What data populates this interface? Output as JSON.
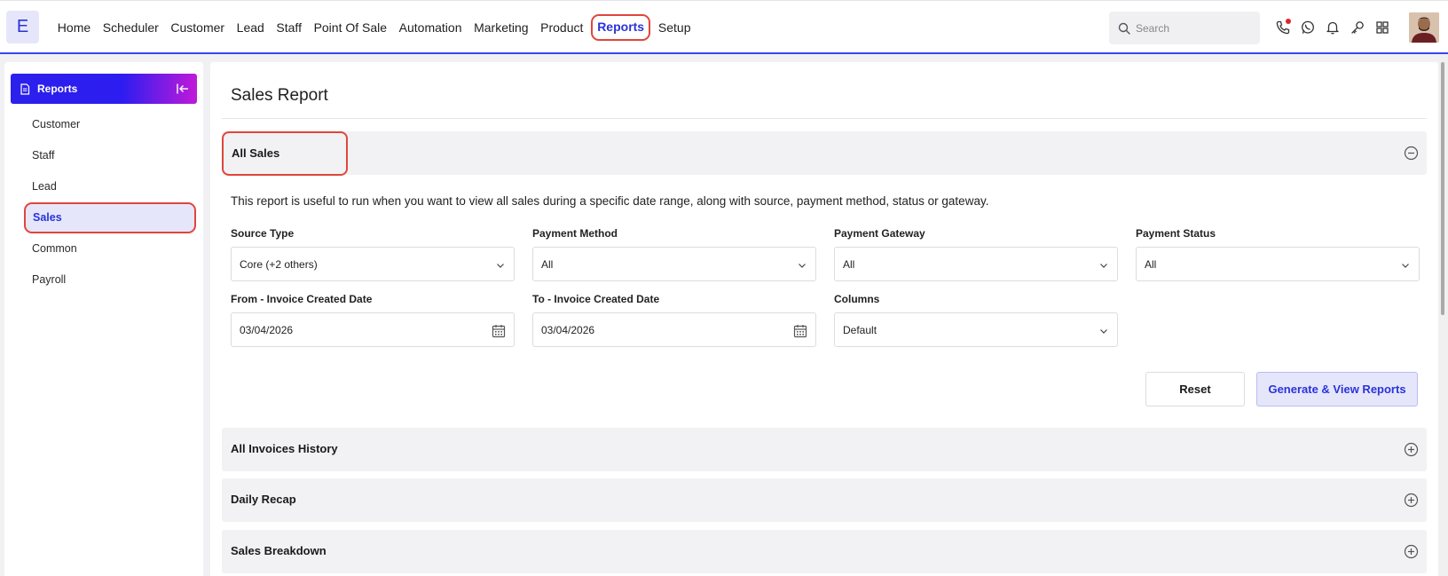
{
  "app": {
    "logo_letter": "E"
  },
  "nav": {
    "items": [
      "Home",
      "Scheduler",
      "Customer",
      "Lead",
      "Staff",
      "Point Of Sale",
      "Automation",
      "Marketing",
      "Product",
      "Reports",
      "Setup"
    ],
    "active": "Reports"
  },
  "search": {
    "placeholder": "Search"
  },
  "header_icons": [
    "phone-icon",
    "whatsapp-icon",
    "bell-icon",
    "key-icon",
    "apps-grid-icon"
  ],
  "sidebar": {
    "title": "Reports",
    "items": [
      "Customer",
      "Staff",
      "Lead",
      "Sales",
      "Common",
      "Payroll"
    ],
    "active": "Sales"
  },
  "main": {
    "page_title": "Sales Report",
    "sections": [
      {
        "title": "All Sales",
        "expanded": true
      },
      {
        "title": "All Invoices History",
        "expanded": false
      },
      {
        "title": "Daily Recap",
        "expanded": false
      },
      {
        "title": "Sales Breakdown",
        "expanded": false
      }
    ],
    "description": "This report is useful to run when you want to view all sales during a specific date range, along with source, payment method, status or gateway.",
    "filters": {
      "source_type": {
        "label": "Source Type",
        "value": "Core (+2 others)"
      },
      "payment_method": {
        "label": "Payment Method",
        "value": "All"
      },
      "payment_gateway": {
        "label": "Payment Gateway",
        "value": "All"
      },
      "payment_status": {
        "label": "Payment Status",
        "value": "All"
      },
      "from_date": {
        "label": "From - Invoice Created Date",
        "value": "03/04/2026"
      },
      "to_date": {
        "label": "To - Invoice Created Date",
        "value": "03/04/2026"
      },
      "columns": {
        "label": "Columns",
        "value": "Default"
      }
    },
    "buttons": {
      "reset": "Reset",
      "generate": "Generate & View Reports"
    }
  },
  "colors": {
    "accent": "#2a33d9",
    "highlight": "#e0463b",
    "active_bg": "#e6e6fb"
  }
}
